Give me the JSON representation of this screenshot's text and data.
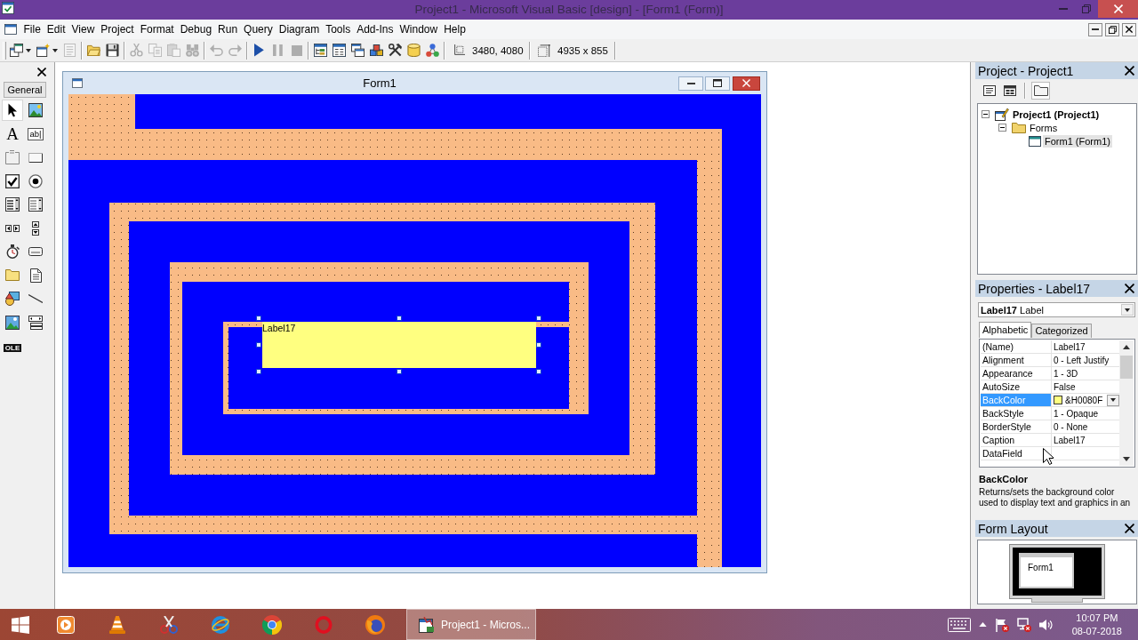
{
  "window": {
    "title": "Project1 - Microsoft Visual Basic [design] - [Form1 (Form)]"
  },
  "menu": {
    "items": [
      "File",
      "Edit",
      "View",
      "Project",
      "Format",
      "Debug",
      "Run",
      "Query",
      "Diagram",
      "Tools",
      "Add-Ins",
      "Window",
      "Help"
    ]
  },
  "toolbar": {
    "groups": [
      [
        {
          "kind": "add-project",
          "disabled": false,
          "dropdown": true
        },
        {
          "kind": "add-form",
          "disabled": false,
          "dropdown": true
        },
        {
          "kind": "menu-editor",
          "disabled": true,
          "dropdown": false
        }
      ],
      [
        {
          "kind": "open",
          "disabled": false,
          "dropdown": false
        },
        {
          "kind": "save",
          "disabled": false,
          "dropdown": false
        }
      ],
      [
        {
          "kind": "cut",
          "disabled": true,
          "dropdown": false
        },
        {
          "kind": "copy",
          "disabled": true,
          "dropdown": false
        },
        {
          "kind": "paste",
          "disabled": true,
          "dropdown": false
        },
        {
          "kind": "find",
          "disabled": true,
          "dropdown": false
        }
      ],
      [
        {
          "kind": "undo",
          "disabled": true,
          "dropdown": false
        },
        {
          "kind": "redo",
          "disabled": true,
          "dropdown": false
        }
      ],
      [
        {
          "kind": "run",
          "disabled": false,
          "dropdown": false
        },
        {
          "kind": "pause",
          "disabled": true,
          "dropdown": false
        },
        {
          "kind": "stop",
          "disabled": true,
          "dropdown": false
        }
      ],
      [
        {
          "kind": "project-explorer",
          "disabled": false,
          "dropdown": false
        },
        {
          "kind": "properties",
          "disabled": false,
          "dropdown": false
        },
        {
          "kind": "form-layout",
          "disabled": false,
          "dropdown": false
        },
        {
          "kind": "object-browser",
          "disabled": false,
          "dropdown": false
        },
        {
          "kind": "toolbox",
          "disabled": false,
          "dropdown": false
        },
        {
          "kind": "data-view",
          "disabled": false,
          "dropdown": false
        },
        {
          "kind": "component-manager",
          "disabled": false,
          "dropdown": false
        }
      ]
    ],
    "position": "3480, 4080",
    "size": "4935 x 855"
  },
  "toolbox": {
    "tab": "General",
    "tools": [
      {
        "kind": "pointer",
        "selected": true
      },
      {
        "kind": "picturebox",
        "selected": false
      },
      {
        "kind": "label",
        "glyph": "A",
        "selected": false
      },
      {
        "kind": "textbox",
        "glyph": "ab|",
        "selected": false
      },
      {
        "kind": "frame",
        "selected": false
      },
      {
        "kind": "commandbutton",
        "selected": false
      },
      {
        "kind": "checkbox",
        "selected": false
      },
      {
        "kind": "optionbutton",
        "selected": false
      },
      {
        "kind": "combobox",
        "selected": false
      },
      {
        "kind": "listbox",
        "selected": false
      },
      {
        "kind": "hscroll",
        "selected": false
      },
      {
        "kind": "vscroll",
        "selected": false
      },
      {
        "kind": "timer",
        "selected": false
      },
      {
        "kind": "drivelist",
        "selected": false
      },
      {
        "kind": "dirlist",
        "selected": false
      },
      {
        "kind": "filelist",
        "selected": false
      },
      {
        "kind": "shape",
        "selected": false
      },
      {
        "kind": "line",
        "selected": false
      },
      {
        "kind": "image",
        "selected": false
      },
      {
        "kind": "data",
        "selected": false
      },
      {
        "kind": "ole",
        "glyph": "OLE",
        "selected": false
      }
    ]
  },
  "designer": {
    "form": {
      "title": "Form1"
    },
    "label": {
      "caption": "Label17",
      "selected": true
    }
  },
  "project": {
    "title": "Project - Project1",
    "buttons": [
      {
        "kind": "view-code",
        "on": false
      },
      {
        "kind": "view-object",
        "on": false
      },
      {
        "kind": "toggle-folders",
        "on": true
      }
    ],
    "tree": [
      {
        "label": "Project1 (Project1)",
        "kind": "project",
        "expanded": true,
        "selected": false,
        "children": [
          {
            "label": "Forms",
            "kind": "folder",
            "expanded": true,
            "selected": false,
            "children": [
              {
                "label": "Form1 (Form1)",
                "kind": "form",
                "selected": true
              }
            ]
          }
        ]
      }
    ]
  },
  "properties": {
    "title": "Properties - Label17",
    "object": "**Label17** Label",
    "tabs": [
      {
        "label": "Alphabetic",
        "selected": true
      },
      {
        "label": "Categorized",
        "selected": false
      }
    ],
    "rows": [
      {
        "name": "(Name)",
        "value": "Label17",
        "kind": "text",
        "selected": false
      },
      {
        "name": "Alignment",
        "value": "0 - Left Justify",
        "kind": "text",
        "selected": false
      },
      {
        "name": "Appearance",
        "value": "1 - 3D",
        "kind": "text",
        "selected": false
      },
      {
        "name": "AutoSize",
        "value": "False",
        "kind": "text",
        "selected": false
      },
      {
        "name": "BackColor",
        "value": "&H0080F",
        "kind": "color",
        "color": "#ffff80",
        "selected": true
      },
      {
        "name": "BackStyle",
        "value": "1 - Opaque",
        "kind": "text",
        "selected": false
      },
      {
        "name": "BorderStyle",
        "value": "0 - None",
        "kind": "text",
        "selected": false
      },
      {
        "name": "Caption",
        "value": "Label17",
        "kind": "text",
        "selected": false
      },
      {
        "name": "DataField",
        "kind": "text",
        "selected": false
      }
    ],
    "description": {
      "title": "BackColor",
      "text": "Returns/sets the background color used to display text and graphics in an"
    }
  },
  "form_layout": {
    "title": "Form Layout",
    "preview": "Form1"
  },
  "taskbar": {
    "pinned": [
      {
        "kind": "media-player"
      },
      {
        "kind": "cone"
      },
      {
        "kind": "snip"
      },
      {
        "kind": "ie"
      },
      {
        "kind": "chrome"
      },
      {
        "kind": "opera"
      },
      {
        "kind": "firefox"
      }
    ],
    "tasks": [
      {
        "label": "Project1 - Micros...",
        "selected": true
      }
    ],
    "tray": [
      {
        "kind": "keyboard"
      },
      {
        "kind": "chevron"
      },
      {
        "kind": "flag"
      },
      {
        "kind": "network"
      },
      {
        "kind": "speaker"
      }
    ],
    "clock": {
      "time": "10:07 PM",
      "date": "08-07-2018"
    }
  }
}
